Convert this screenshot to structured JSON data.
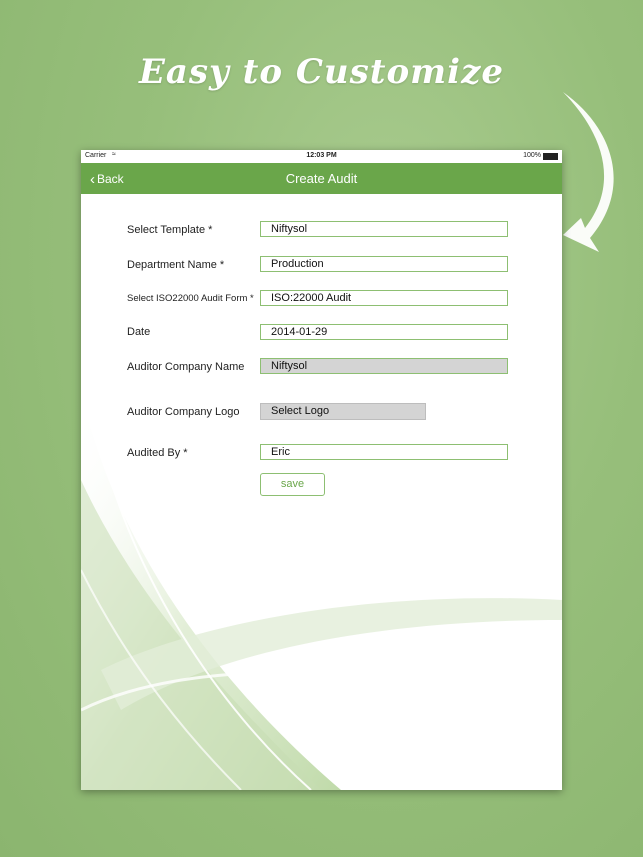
{
  "promo": {
    "headline": "Easy to Customize"
  },
  "status_bar": {
    "carrier": "Carrier",
    "time": "12:03 PM",
    "battery": "100%"
  },
  "nav": {
    "back_label": "Back",
    "title": "Create Audit"
  },
  "form": {
    "fields": [
      {
        "label": "Select Template *",
        "value": "Niftysol"
      },
      {
        "label": "Department Name *",
        "value": "Production"
      },
      {
        "label": "Select ISO22000 Audit Form *",
        "value": "ISO:22000 Audit"
      },
      {
        "label": "Date",
        "value": "2014-01-29"
      },
      {
        "label": "Auditor Company Name",
        "value": "Niftysol"
      },
      {
        "label": "Auditor Company Logo",
        "value": "Select Logo"
      },
      {
        "label": "Audited By *",
        "value": "Eric"
      }
    ],
    "save_label": "save"
  },
  "colors": {
    "accent": "#6aa64a",
    "background": "#97bf7b",
    "field_border": "#8dbf72"
  },
  "icons": [
    "wifi-icon",
    "battery-icon",
    "back-chevron-icon",
    "curved-arrow-icon"
  ]
}
